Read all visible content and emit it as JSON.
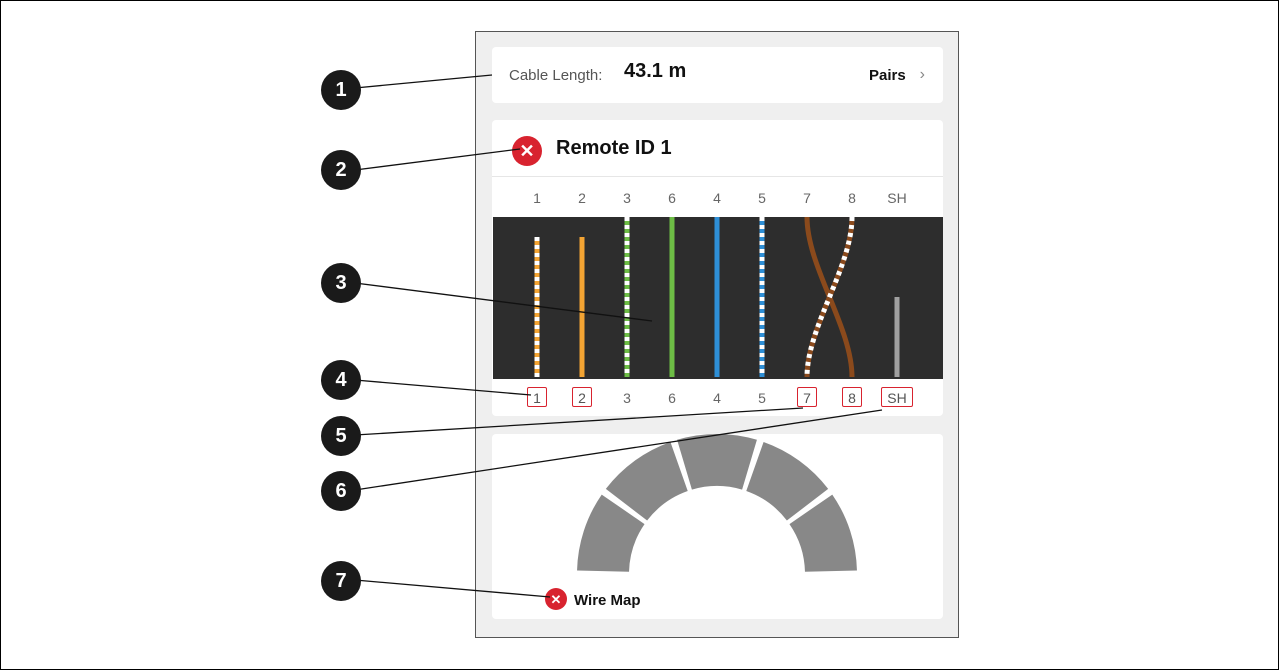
{
  "cable_length": {
    "label": "Cable Length:",
    "value": "43.1 m",
    "pairs_label": "Pairs",
    "chevron": "›"
  },
  "remote": {
    "title": "Remote ID 1",
    "fail_icon": "✕"
  },
  "pins_top": [
    "1",
    "2",
    "3",
    "6",
    "4",
    "5",
    "7",
    "8",
    "SH"
  ],
  "pins_bottom": [
    "1",
    "2",
    "3",
    "6",
    "4",
    "5",
    "7",
    "8",
    "SH"
  ],
  "pins_bottom_failed": [
    "1",
    "2",
    "7",
    "8",
    "SH"
  ],
  "wiremap": {
    "label": "Wire Map",
    "fail_icon": "✕"
  },
  "callouts": [
    "1",
    "2",
    "3",
    "4",
    "5",
    "6",
    "7"
  ],
  "colors": {
    "orange": "#f3a433",
    "green": "#6dbd45",
    "blue": "#2e8fd6",
    "brown": "#8b4a1c",
    "shield": "#a0a0a0",
    "fail": "#d8232f",
    "dark_bg": "#2d2d2d",
    "segment": "#888888"
  }
}
